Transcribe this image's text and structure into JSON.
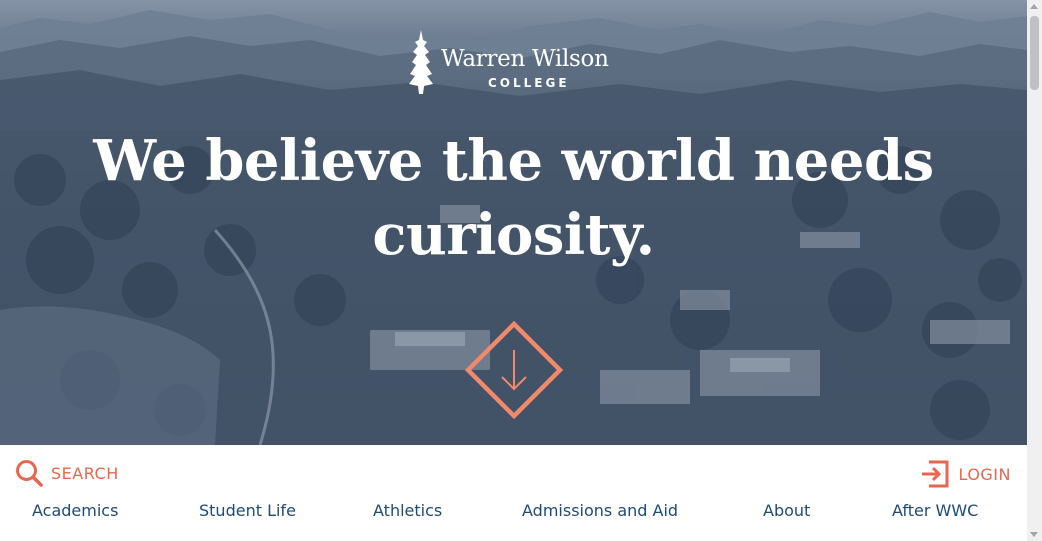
{
  "hero": {
    "logo": {
      "name": "Warren Wilson",
      "subtitle": "COLLEGE"
    },
    "headline": "We believe the world needs curiosity."
  },
  "utility": {
    "search_label": "SEARCH",
    "login_label": "LOGIN"
  },
  "nav": {
    "items": [
      {
        "label": "Academics"
      },
      {
        "label": "Student Life"
      },
      {
        "label": "Athletics"
      },
      {
        "label": "Admissions and Aid"
      },
      {
        "label": "About"
      },
      {
        "label": "After WWC"
      }
    ]
  },
  "colors": {
    "accent": "#e8664f",
    "nav_text": "#1e4a78",
    "hero_overlay": "#3c4c5f"
  },
  "icons": {
    "logo": "tree-icon",
    "search": "search-icon",
    "login": "login-icon",
    "scroll": "arrow-down-diamond-icon"
  }
}
